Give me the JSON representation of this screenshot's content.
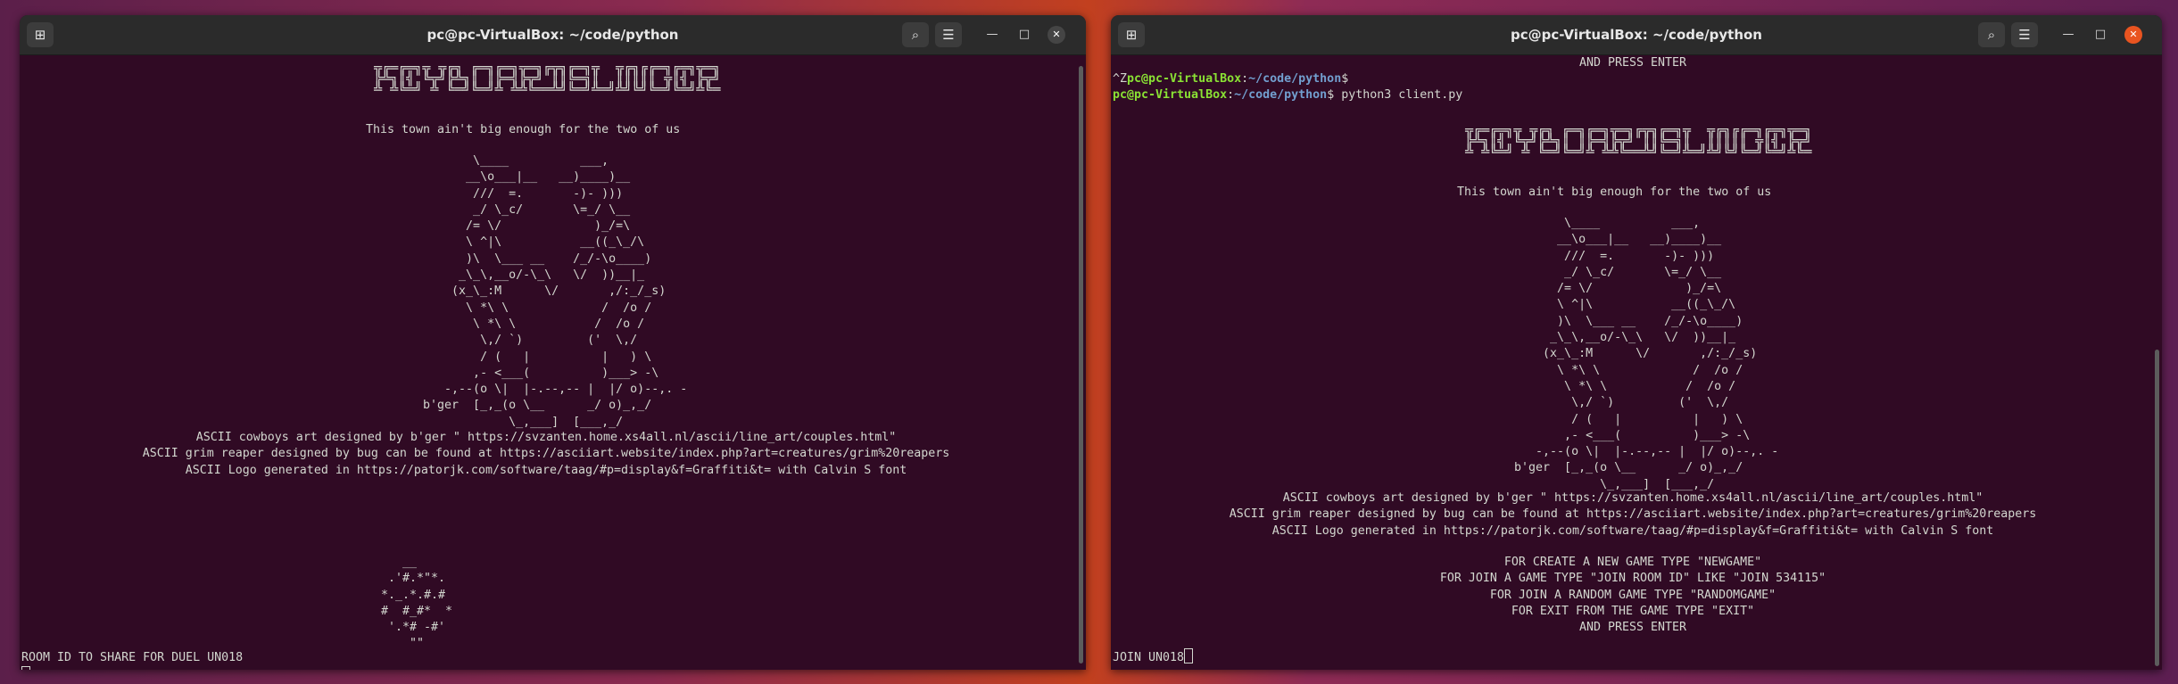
{
  "left": {
    "title": "pc@pc-VirtualBox: ~/code/python",
    "logo": " ╦╔═╔═╗╦ ╦╔╗ ╔═╗╔═╗╦═╗╔╦╗╔═╗╦  ╦╔╗╔╔═╗╔═╗╦═╗\n ╠╩╗║╣ ╚╦╝╠╩╗║ ║╠═╣╠╦╝ ║║╚═╗║  ║║║║║ ╦║╣ ╠╦╝\n ╩ ╩╚═╝ ╩ ╚═╝╚═╝╩ ╩╩╚══╩╝╚═╝╩═╝╩╝╚╝╚═╝╚═╝╩╚═",
    "tagline": "This town ain't big enough for the two of us",
    "art": "           \\____          ___,\n          __\\o___|__   __)____)__\n           ///  =.       -)- )))\n           _/ \\_c/       \\=_/ \\__\n          /= \\/             )_/=\\\n          \\ ^|\\           __((_\\_/\\\n          )\\  \\___ __    /_/-\\o____)\n         _\\_\\,__o/-\\_\\   \\/  ))__|_\n        (x_\\_:M      \\/       ,/:_/_s)\n          \\ *\\ \\             /  /o /\n           \\ *\\ \\           /  /o /\n            \\,/ `)         ('  \\,/\n            / (   |          |   ) \\\n           ,- <___(          )___> -\\\n       -,--(o \\|  |-.--,-- |  |/ o)--,. -\n    b'ger  [_,_(o \\__      _/ o)_,_/\n                \\_,___]  [___,_/",
    "credits": [
      "ASCII cowboys art designed by b'ger \" https://svzanten.home.xs4all.nl/ascii/line_art/couples.html\"",
      "ASCII grim reaper designed by bug can be found at https://asciiart.website/index.php?art=creatures/grim%20reapers",
      "ASCII Logo generated in https://patorjk.com/software/taag/#p=display&f=Graffiti&t= with Calvin S font"
    ],
    "dust": "   __\n .'#.*\"*.\n*._.*.#.#\n#  #_#*  *\n '.*# -#'\n    \"\"",
    "room_msg": "ROOM ID TO SHARE FOR DUEL UN018"
  },
  "right": {
    "title": "pc@pc-VirtualBox: ~/code/python",
    "top_line": "AND PRESS ENTER",
    "prompt1_prefix": "^Z",
    "prompt_user": "pc@pc-VirtualBox",
    "prompt_path": "~/code/python",
    "prompt1_cmd": "",
    "prompt2_cmd": "python3 client.py",
    "menu": [
      "FOR CREATE A NEW GAME TYPE \"NEWGAME\"",
      "FOR JOIN A GAME TYPE \"JOIN ROOM ID\" LIKE \"JOIN 534115\"",
      "FOR JOIN A RANDOM GAME TYPE \"RANDOMGAME\"",
      "FOR EXIT FROM THE GAME TYPE \"EXIT\"",
      "AND PRESS ENTER"
    ],
    "input": "JOIN UN018"
  },
  "icons": {
    "new_tab": "new-tab-icon",
    "search": "search-icon",
    "menu": "hamburger-menu-icon",
    "minimize": "minimize-icon",
    "maximize": "maximize-icon",
    "close": "close-icon"
  },
  "colors": {
    "terminal_bg": "#300a24",
    "user_green": "#8ae234",
    "path_blue": "#729fcf",
    "close_active": "#e95420"
  }
}
